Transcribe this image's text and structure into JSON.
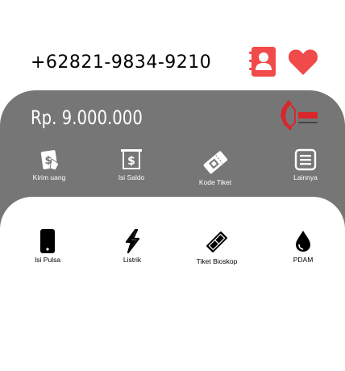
{
  "header": {
    "phone_number": "+62821-9834-9210",
    "icons": [
      "contacts-icon",
      "heart-icon"
    ],
    "colors": {
      "accent": "#f04a4a"
    }
  },
  "balance_card": {
    "balance": "Rp. 9.000.000",
    "brand_logo_icon": "brand-logo-icon",
    "background_color": "#767676",
    "actions": [
      {
        "label": "Kirim uang",
        "icon": "send-money-icon"
      },
      {
        "label": "Isi Saldo",
        "icon": "top-up-icon"
      },
      {
        "label": "Kode Tiket",
        "icon": "ticket-code-icon"
      },
      {
        "label": "Lainnya",
        "icon": "more-icon"
      }
    ]
  },
  "services": {
    "items": [
      {
        "label": "Isi Pulsa",
        "icon": "mobile-phone-icon"
      },
      {
        "label": "Listrik",
        "icon": "lightning-icon"
      },
      {
        "label": "Tiket Bioskop",
        "icon": "movie-ticket-icon"
      },
      {
        "label": "PDAM",
        "icon": "water-drop-icon"
      }
    ]
  }
}
